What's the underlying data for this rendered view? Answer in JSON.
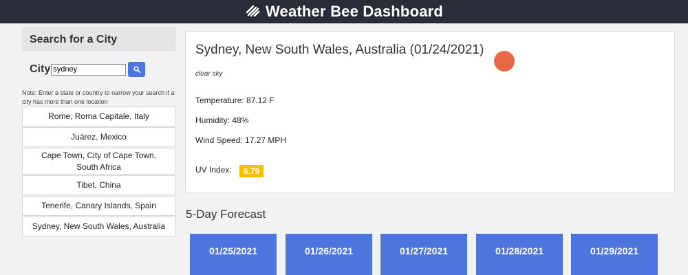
{
  "header": {
    "title": "Weather Bee Dashboard",
    "logo_icon": "wind-icon"
  },
  "sidebar": {
    "title": "Search for a City",
    "city_label": "City",
    "search_value": "sydney",
    "search_icon": "search-icon",
    "note": "Note: Enter a state or country to narrow your search if a city has more than one location",
    "history": [
      "Rome, Roma Capitale, Italy",
      "Juárez, Mexico",
      "Cape Town, City of Cape Town, South Africa",
      "Tibet, China",
      "Tenerife, Canary Islands, Spain",
      "Sydney, New South Wales, Australia"
    ]
  },
  "current": {
    "heading": "Sydney, New South Wales, Australia (01/24/2021)",
    "description": "clear sky",
    "temperature": "Temperature: 87.12 F",
    "humidity": "Humidity: 48%",
    "wind": "Wind Speed: 17.27 MPH",
    "uv_label": "UV Index:",
    "uv_value": "6.79",
    "uv_color": "#f5c000"
  },
  "forecast": {
    "title": "5-Day Forecast",
    "days": [
      "01/25/2021",
      "01/26/2021",
      "01/27/2021",
      "01/28/2021",
      "01/29/2021"
    ],
    "card_color": "#4c75e0"
  }
}
